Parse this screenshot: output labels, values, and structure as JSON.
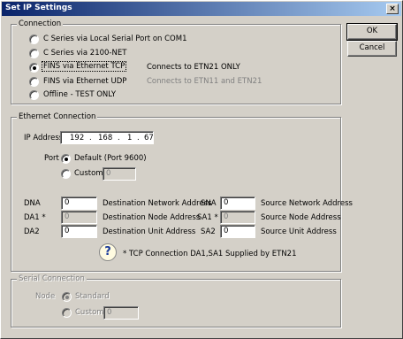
{
  "window": {
    "title": "Set IP Settings",
    "close_symbol": "×"
  },
  "buttons": {
    "ok": "OK",
    "cancel": "Cancel"
  },
  "connection": {
    "legend": "Connection",
    "options": [
      {
        "label": "C Series via Local Serial Port on COM1",
        "checked": false
      },
      {
        "label": "C Series via 2100-NET",
        "checked": false
      },
      {
        "label": "FINS via Ethernet TCP",
        "checked": true
      },
      {
        "label": "FINS via Ethernet UDP",
        "checked": false
      },
      {
        "label": "Offline - TEST ONLY",
        "checked": false
      }
    ],
    "tcp_note": "Connects to ETN21 ONLY",
    "udp_note": "Connects to ETN11 and ETN21"
  },
  "ethernet": {
    "legend": "Ethernet Connection",
    "ip_label": "IP Address",
    "ip": [
      "192",
      "168",
      "1",
      "67"
    ],
    "port_label": "Port",
    "port_default": "Default (Port 9600)",
    "port_custom": "Custom",
    "port_custom_value": "0",
    "dna_label": "DNA",
    "dna_value": "0",
    "dna_desc": "Destination Network Address",
    "da1_label": "DA1 *",
    "da1_value": "0",
    "da1_desc": "Destination Node Address",
    "da2_label": "DA2",
    "da2_value": "0",
    "da2_desc": "Destination Unit Address",
    "sna_label": "SNA",
    "sna_value": "0",
    "sna_desc": "Source Network Address",
    "sa1_label": "SA1 *",
    "sa1_value": "0",
    "sa1_desc": "Source Node Address",
    "sa2_label": "SA2",
    "sa2_value": "0",
    "sa2_desc": "Source Unit Address",
    "footnote": "* TCP Connection DA1,SA1 Supplied by ETN21"
  },
  "serial": {
    "legend": "Serial Connection",
    "node_label": "Node",
    "standard": "Standard",
    "custom": "Custom",
    "custom_value": "0"
  }
}
